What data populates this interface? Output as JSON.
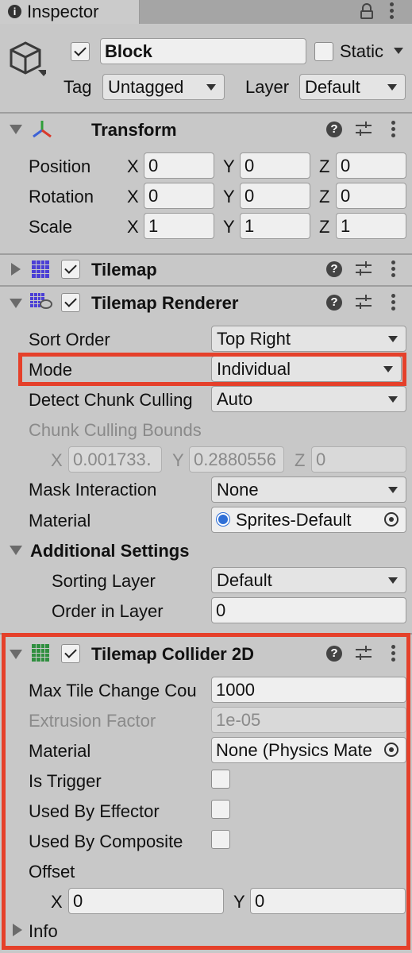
{
  "tab": {
    "title": "Inspector"
  },
  "object": {
    "active": true,
    "name": "Block",
    "static_label": "Static",
    "static": false,
    "tag_label": "Tag",
    "tag_value": "Untagged",
    "layer_label": "Layer",
    "layer_value": "Default"
  },
  "transform": {
    "title": "Transform",
    "rows": [
      {
        "label": "Position",
        "x": "0",
        "y": "0",
        "z": "0"
      },
      {
        "label": "Rotation",
        "x": "0",
        "y": "0",
        "z": "0"
      },
      {
        "label": "Scale",
        "x": "1",
        "y": "1",
        "z": "1"
      }
    ],
    "axis": {
      "x": "X",
      "y": "Y",
      "z": "Z"
    }
  },
  "tilemap": {
    "title": "Tilemap",
    "enabled": true
  },
  "renderer": {
    "title": "Tilemap Renderer",
    "enabled": true,
    "sort_order_label": "Sort Order",
    "sort_order_value": "Top Right",
    "mode_label": "Mode",
    "mode_value": "Individual",
    "detect_label": "Detect Chunk Culling",
    "detect_value": "Auto",
    "bounds_label": "Chunk Culling Bounds",
    "bounds_x": "0.001733․",
    "bounds_y": "0.2880556",
    "bounds_z": "0",
    "mask_label": "Mask Interaction",
    "mask_value": "None",
    "material_label": "Material",
    "material_value": "Sprites-Default",
    "additional_label": "Additional Settings",
    "sorting_layer_label": "Sorting Layer",
    "sorting_layer_value": "Default",
    "order_label": "Order in Layer",
    "order_value": "0"
  },
  "collider": {
    "title": "Tilemap Collider 2D",
    "enabled": true,
    "max_tile_label": "Max Tile Change Cou",
    "max_tile_value": "1000",
    "extrusion_label": "Extrusion Factor",
    "extrusion_value": "1e-05",
    "material_label": "Material",
    "material_value": "None (Physics Mate",
    "trigger_label": "Is Trigger",
    "effector_label": "Used By Effector",
    "composite_label": "Used By Composite",
    "offset_label": "Offset",
    "offset_x": "0",
    "offset_y": "0",
    "info_label": "Info"
  },
  "colors": {
    "highlight": "#e5402a",
    "tile_icon": "#4b3fd6",
    "collider_icon": "#2f8f3f"
  }
}
